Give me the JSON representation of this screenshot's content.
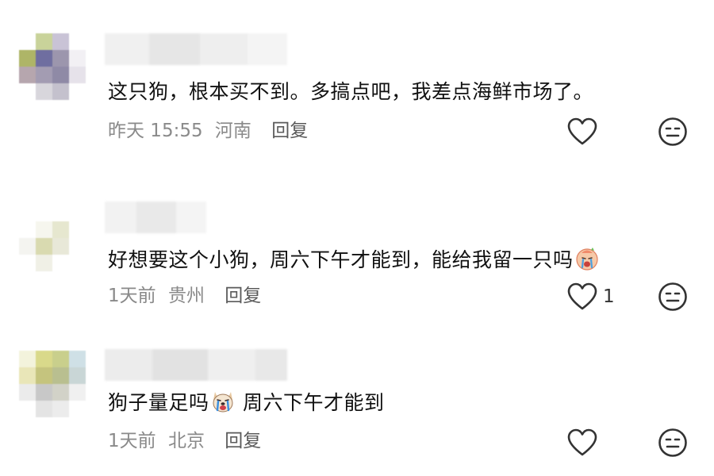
{
  "comments": [
    {
      "text": "这只狗，根本买不到。多搞点吧，我差点海鲜市场了。",
      "time": "昨天 15:55",
      "location": "河南",
      "reply_label": "回复",
      "like_count": ""
    },
    {
      "text": "好想要这个小狗，周六下午才能到，能给我留一只吗",
      "time": "1天前",
      "location": "贵州",
      "reply_label": "回复",
      "like_count": "1"
    },
    {
      "text_before": "狗子量足吗",
      "text_after": "周六下午才能到",
      "time": "1天前",
      "location": "北京",
      "reply_label": "回复",
      "like_count": ""
    }
  ],
  "icons": {
    "like": "heart-outline-icon",
    "dislike": "neutral-face-icon",
    "emoji_1": "crying-face-emoji",
    "emoji_2": "crying-dog-emoji"
  },
  "colors": {
    "text": "#111111",
    "meta": "#8a8a8a",
    "reply": "#5a5a5a",
    "icon": "#333333"
  }
}
